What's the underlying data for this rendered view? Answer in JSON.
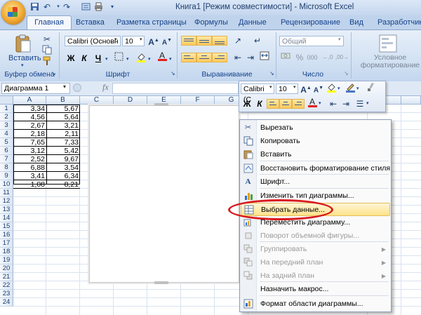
{
  "window": {
    "title": "Книга1  [Режим совместимости] - Microsoft Excel"
  },
  "qat_icons": [
    "save-icon",
    "undo-icon",
    "redo-icon",
    "customize-icon"
  ],
  "tabs": [
    "Главная",
    "Вставка",
    "Разметка страницы",
    "Формулы",
    "Данные",
    "Рецензирование",
    "Вид",
    "Разработчик"
  ],
  "ribbon": {
    "clipboard": {
      "paste_label": "Вставить",
      "group_label": "Буфер обмена"
    },
    "font": {
      "font_name": "Calibri (Основн",
      "font_size": "10",
      "bold": "Ж",
      "italic": "К",
      "underline": "Ч",
      "group_label": "Шрифт"
    },
    "alignment": {
      "group_label": "Выравнивание"
    },
    "number": {
      "format": "Общий",
      "percent": "%",
      "thousands": "000",
      "group_label": "Число"
    },
    "styles": {
      "conditional_label": "Условное форматирование"
    }
  },
  "formula_bar": {
    "name_box": "Диаграмма 1",
    "fx": "fx"
  },
  "sheet": {
    "columns": [
      "A",
      "B",
      "C",
      "D",
      "E",
      "F",
      "G",
      "L"
    ],
    "rows": [
      "1",
      "2",
      "3",
      "4",
      "5",
      "6",
      "7",
      "8",
      "9",
      "10",
      "11",
      "12",
      "13",
      "14",
      "15",
      "16",
      "17",
      "18",
      "19",
      "20",
      "21",
      "22",
      "23",
      "24"
    ],
    "data": [
      [
        "3,34",
        "5,67"
      ],
      [
        "4,56",
        "5,64"
      ],
      [
        "2,67",
        "3,21"
      ],
      [
        "2,18",
        "2,11"
      ],
      [
        "7,65",
        "7,33"
      ],
      [
        "3,12",
        "5,42"
      ],
      [
        "2,52",
        "9,67"
      ],
      [
        "6,88",
        "3,54"
      ],
      [
        "3,41",
        "6,34"
      ],
      [
        "1,08",
        "8,21"
      ]
    ]
  },
  "mini_toolbar": {
    "font_name": "Calibri (С",
    "font_size": "10",
    "bold": "Ж",
    "italic": "К"
  },
  "context_menu": {
    "items": [
      {
        "label": "Вырезать",
        "icon": "scissors-icon",
        "enabled": true
      },
      {
        "label": "Копировать",
        "icon": "copy-icon",
        "enabled": true
      },
      {
        "label": "Вставить",
        "icon": "paste-icon",
        "enabled": true
      },
      {
        "label": "Восстановить форматирование стиля",
        "icon": "reset-style-icon",
        "enabled": true
      },
      {
        "label": "Шрифт...",
        "icon": "font-icon",
        "enabled": true
      },
      {
        "label": "Изменить тип диаграммы...",
        "icon": "chart-type-icon",
        "enabled": true
      },
      {
        "label": "Выбрать данные...",
        "icon": "select-data-icon",
        "enabled": true,
        "highlighted": true
      },
      {
        "label": "Переместить диаграмму...",
        "icon": "move-chart-icon",
        "enabled": true
      },
      {
        "label": "Поворот объемной фигуры...",
        "icon": "rotate-3d-icon",
        "enabled": false
      },
      {
        "label": "Группировать",
        "icon": "group-icon",
        "enabled": false,
        "submenu": true
      },
      {
        "label": "На передний план",
        "icon": "bring-front-icon",
        "enabled": false,
        "submenu": true
      },
      {
        "label": "На задний план",
        "icon": "send-back-icon",
        "enabled": false,
        "submenu": true
      },
      {
        "label": "Назначить макрос...",
        "icon": "macro-icon",
        "enabled": true
      },
      {
        "label": "Формат области диаграммы...",
        "icon": "format-area-icon",
        "enabled": true
      }
    ]
  }
}
